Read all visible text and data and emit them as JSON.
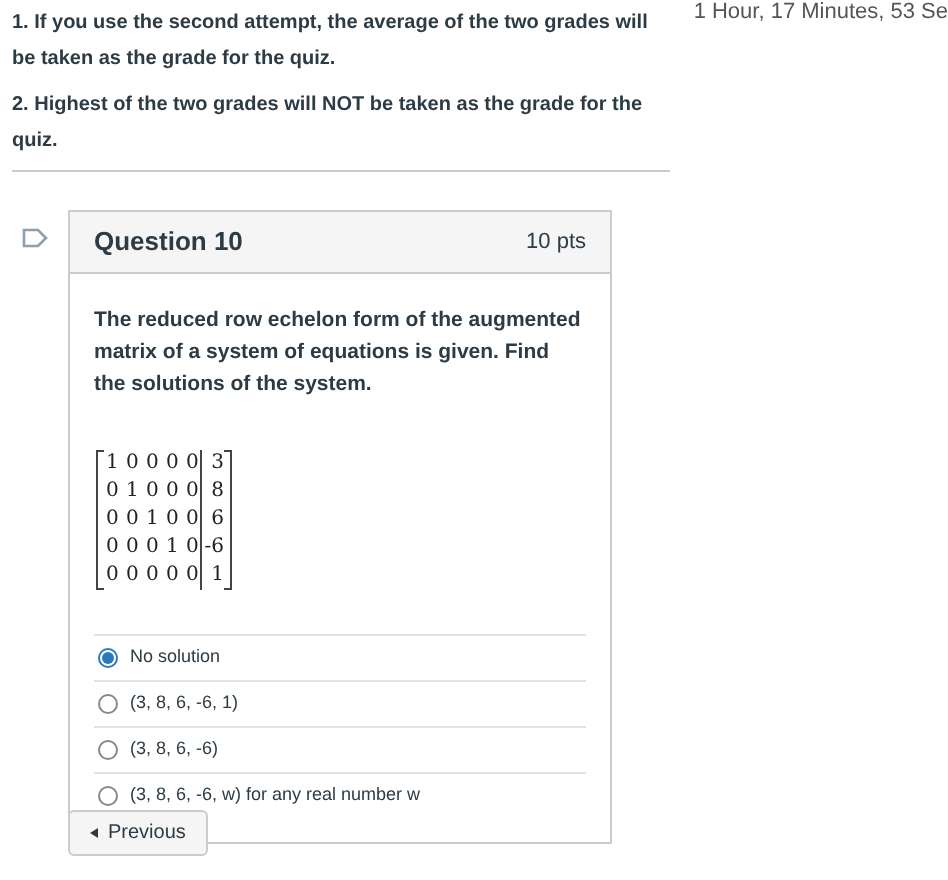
{
  "notes": [
    "1. If you use the second attempt, the average of the two grades will be taken as the grade for the quiz.",
    "2. Highest of the two grades will NOT be taken as the grade for the quiz."
  ],
  "timer": "1 Hour, 17 Minutes, 53 Se",
  "question": {
    "title": "Question 10",
    "points": "10 pts",
    "flagged": false,
    "text": "The reduced row echelon form of the augmented matrix of a system of equations is given. Find the solutions of the system.",
    "matrix": [
      {
        "coefficients": [
          "1",
          "0",
          "0",
          "0",
          "0"
        ],
        "constant": "3"
      },
      {
        "coefficients": [
          "0",
          "1",
          "0",
          "0",
          "0"
        ],
        "constant": "8"
      },
      {
        "coefficients": [
          "0",
          "0",
          "1",
          "0",
          "0"
        ],
        "constant": "6"
      },
      {
        "coefficients": [
          "0",
          "0",
          "0",
          "1",
          "0"
        ],
        "constant": "-6"
      },
      {
        "coefficients": [
          "0",
          "0",
          "0",
          "0",
          "0"
        ],
        "constant": "1"
      }
    ],
    "options": [
      {
        "label": "No solution",
        "selected": true
      },
      {
        "label": "(3, 8, 6, -6, 1)",
        "selected": false
      },
      {
        "label": "(3, 8, 6, -6)",
        "selected": false
      },
      {
        "label": "(3, 8, 6, -6, w) for any real number w",
        "selected": false
      }
    ]
  },
  "nav": {
    "previous": "Previous"
  }
}
